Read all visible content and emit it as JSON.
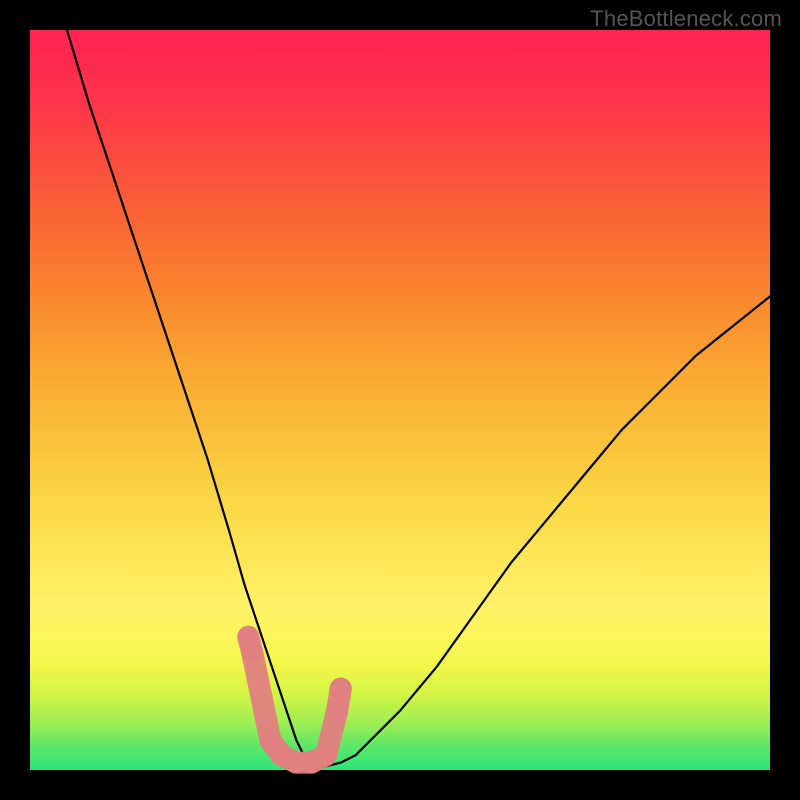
{
  "watermark": "TheBottleneck.com",
  "chart_data": {
    "type": "line",
    "title": "",
    "xlabel": "",
    "ylabel": "",
    "xlim": [
      0,
      100
    ],
    "ylim": [
      0,
      100
    ],
    "grid": false,
    "legend": false,
    "series": [
      {
        "name": "bottleneck-curve",
        "color": "#000000",
        "x": [
          5,
          8,
          12,
          16,
          20,
          24,
          27,
          29,
          31,
          33,
          34,
          35,
          36,
          37,
          38,
          39,
          40,
          42,
          44,
          46,
          50,
          55,
          60,
          65,
          70,
          75,
          80,
          85,
          90,
          95,
          100
        ],
        "y": [
          100,
          90,
          78,
          66,
          54,
          42,
          32,
          25,
          19,
          13,
          10,
          7,
          4,
          2,
          1,
          0.5,
          0.5,
          1,
          2,
          4,
          8,
          14,
          21,
          28,
          34,
          40,
          46,
          51,
          56,
          60,
          64
        ]
      },
      {
        "name": "data-markers",
        "color": "#e08080",
        "type": "scatter",
        "x": [
          29.5,
          30.0,
          32.5,
          34.0,
          36.0,
          38.0,
          40.0,
          41.5,
          42.0
        ],
        "y": [
          18,
          16,
          4,
          2,
          1,
          1,
          2,
          8,
          11
        ]
      }
    ],
    "background_gradient": {
      "direction": "vertical",
      "stops": [
        {
          "pos": 0,
          "color": "#2fe57a"
        },
        {
          "pos": 20,
          "color": "#fff268"
        },
        {
          "pos": 60,
          "color": "#f98a2e"
        },
        {
          "pos": 100,
          "color": "#ff2452"
        }
      ]
    }
  }
}
